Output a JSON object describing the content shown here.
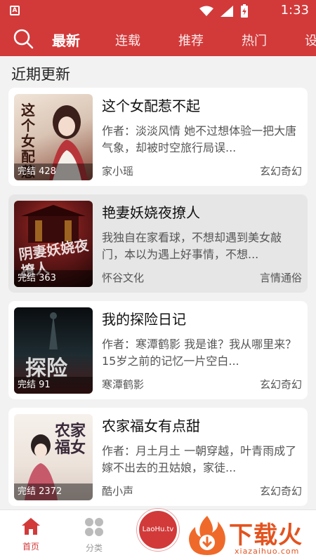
{
  "status_bar": {
    "time": "1:33",
    "app_indicator": "A"
  },
  "top_nav": {
    "tabs": [
      {
        "label": "最新",
        "active": true
      },
      {
        "label": "连载"
      },
      {
        "label": "推荐"
      },
      {
        "label": "热门"
      },
      {
        "label": "设"
      }
    ]
  },
  "section": {
    "title": "近期更新"
  },
  "books": [
    {
      "title": "这个女配惹不起",
      "desc": "作者：淡淡风情 她不过想体验一把大唐气象，却被时空旅行局误...",
      "author": "家小瑶",
      "genre": "玄幻奇幻",
      "badge": "完结 428",
      "cover_colors": [
        "#e9d9cc",
        "#7a3b2a"
      ],
      "cover_text": "这个女配惹不起"
    },
    {
      "title": "艳妻妖娆夜撩人",
      "desc": "我独自在家看球，不想却遇到美女敲门，本以为遇上好事情，不想...",
      "author": "怀谷文化",
      "genre": "言情通俗",
      "badge": "完结 363",
      "cover_colors": [
        "#6e1a1a",
        "#2a0808"
      ],
      "cover_text": "阴妻妖娆夜撩人"
    },
    {
      "title": "我的探险日记",
      "desc": "作者：寒潭鹤影 我是谁？我从哪里来？15岁之前的记忆一片空白...",
      "author": "寒潭鹤影",
      "genre": "玄幻奇幻",
      "badge": "完结 91",
      "cover_colors": [
        "#1b2a2e",
        "#0b0f12"
      ],
      "cover_text": "探险"
    },
    {
      "title": "农家福女有点甜",
      "desc": "作者：月土月土 一朝穿越，叶青雨成了嫁不出去的丑姑娘，家徒...",
      "author": "酷小声",
      "genre": "玄幻奇幻",
      "badge": "完结 2372",
      "cover_colors": [
        "#f3ece6",
        "#c9b7b0"
      ],
      "cover_text": "农家福女"
    }
  ],
  "bottom_nav": {
    "home": {
      "label": "首页",
      "icon": "home-icon"
    },
    "category": {
      "label": "分类",
      "icon": "grid-icon"
    },
    "center_logo": "LaoHu.tv",
    "watermark": {
      "text": "下载火",
      "url": "xiazaihuo.com"
    }
  },
  "colors": {
    "brand": "#d23a3a",
    "watermark": "#e3531f"
  }
}
